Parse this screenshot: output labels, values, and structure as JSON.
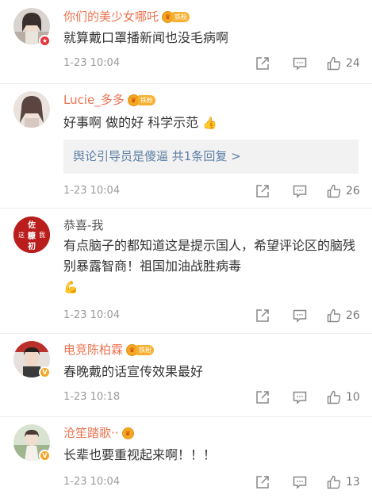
{
  "comments": [
    {
      "username": "你们的美少女哪吒",
      "fan_badge": "铁粉",
      "badge_crown": "♛",
      "text": "就算戴口罩播新闻也没毛病啊",
      "time": "1-23 10:04",
      "likes": "24",
      "avatar_badge": "★",
      "icons": [
        "share-icon",
        "comment-icon",
        "like-icon"
      ]
    },
    {
      "username": "Lucie_多多",
      "fan_badge": "铁粉",
      "badge_crown": "♛",
      "text": "好事啊 做的好 科学示范",
      "emoji": "👍",
      "reply_preview": "舆论引导员是傻逼  共1条回复 >",
      "time": "1-23 10:04",
      "likes": "26",
      "icons": [
        "share-icon",
        "comment-icon",
        "like-icon"
      ]
    },
    {
      "username": "恭喜-我",
      "text": "有点脑子的都知道这是提示国人，希望评论区的脑残别暴露智商！祖国加油战胜病毒",
      "emoji": "💪",
      "time": "1-23 10:04",
      "likes": "26",
      "avatar_text": "佐\n这 糠 我\n初",
      "icons": [
        "share-icon",
        "comment-icon",
        "like-icon"
      ]
    },
    {
      "username": "电竞陈柏霖",
      "fan_badge": "铁粉",
      "badge_crown": "♛",
      "text": "春晚戴的话宣传效果最好",
      "time": "1-23 10:18",
      "likes": "10",
      "avatar_badge": "V",
      "icons": [
        "share-icon",
        "comment-icon",
        "like-icon"
      ]
    },
    {
      "username": "沧笙踏歌··",
      "badge_crown": "♛",
      "text": "长辈也要重视起来啊！！！",
      "time": "1-23 10:04",
      "likes": "13",
      "avatar_badge": "V",
      "icons": [
        "share-icon",
        "comment-icon",
        "like-icon"
      ]
    }
  ]
}
